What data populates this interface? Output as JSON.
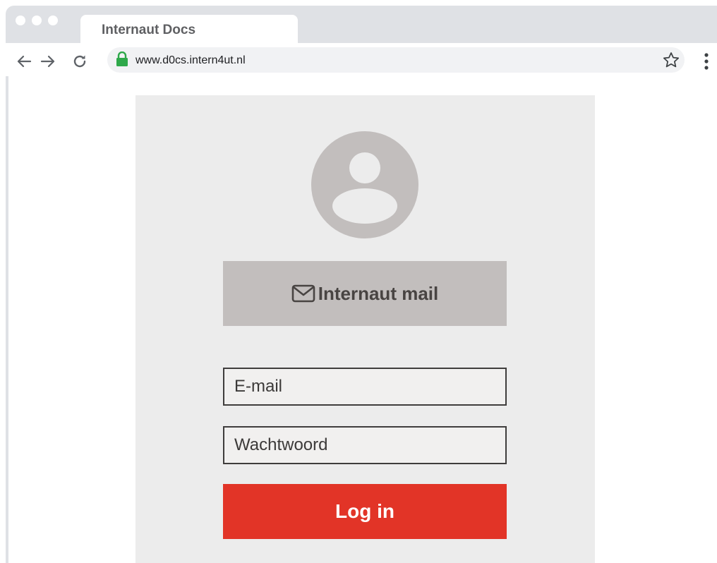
{
  "browser": {
    "tab_title": "Internaut Docs",
    "url": "www.d0cs.intern4ut.nl",
    "icons": {
      "back": "arrow-left-icon",
      "forward": "arrow-right-icon",
      "reload": "reload-icon",
      "lock": "lock-icon",
      "bookmark": "star-icon",
      "menu": "kebab-menu-icon"
    },
    "colors": {
      "lock": "#2ea84a",
      "chrome": "#dfe1e5",
      "omnibox": "#f1f2f4"
    }
  },
  "login": {
    "avatar_icon": "user-avatar-icon",
    "mail_button_label": "Internaut mail",
    "mail_icon": "envelope-icon",
    "email_placeholder": "E-mail",
    "password_placeholder": "Wachtwoord",
    "login_button_label": "Log in",
    "colors": {
      "card": "#ececec",
      "mail_button": "#c2bebd",
      "login_button": "#e23427"
    }
  }
}
